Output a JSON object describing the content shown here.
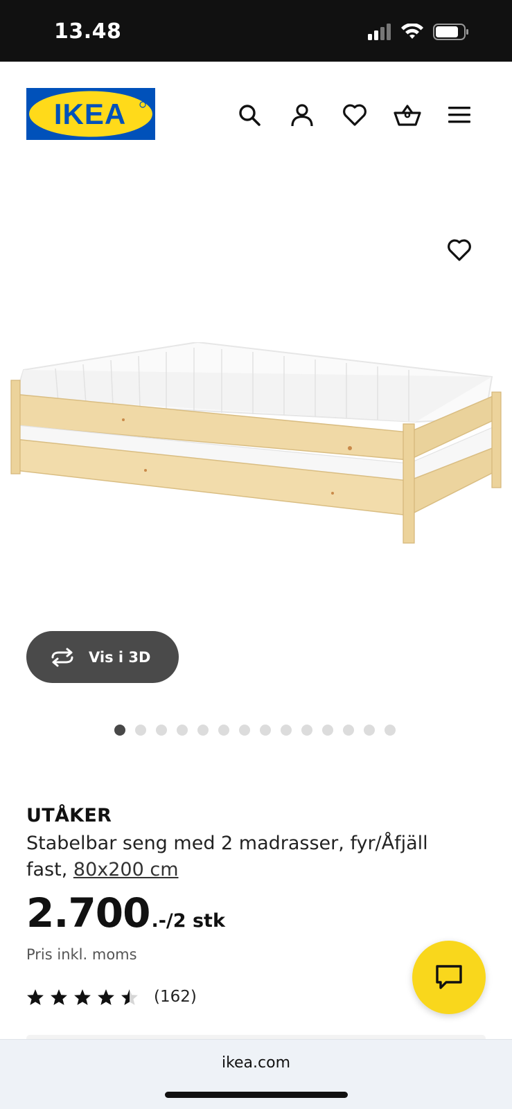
{
  "status_bar": {
    "time": "13.48",
    "signal": "signal-icon",
    "wifi": "wifi-icon",
    "battery": "battery-icon"
  },
  "header": {
    "logo_text": "IKEA",
    "logo_colors": {
      "background": "#0051ba",
      "oval": "#ffda1a",
      "text": "#0051ba"
    },
    "nav_icons": [
      "search-icon",
      "account-icon",
      "heart-icon",
      "basket-icon",
      "menu-icon"
    ]
  },
  "gallery": {
    "favorite_icon": "heart-icon",
    "view_3d_label": "Vis i 3D",
    "dot_count": 14,
    "active_dot": 0
  },
  "product": {
    "name": "UTÅKER",
    "description": "Stabelbar seng med 2 madrasser, fyr/Åfjäll fast,",
    "size_link": "80x200 cm",
    "price": "2.700",
    "price_unit": ".-/2 stk",
    "vat_note": "Pris inkl. moms",
    "rating": 4.5,
    "rating_max": 5,
    "review_count": "(162)"
  },
  "chat": {
    "icon": "chat-icon",
    "color": "#f9d71c"
  },
  "browser": {
    "url": "ikea.com"
  }
}
